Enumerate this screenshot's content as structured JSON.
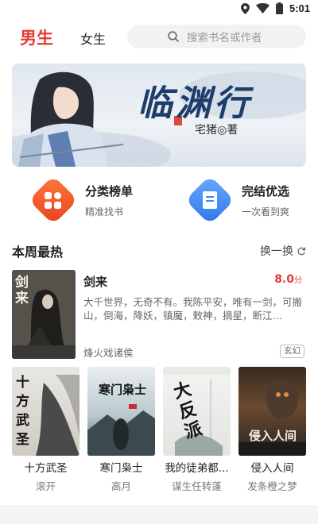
{
  "status_bar": {
    "time": "5:01",
    "icons": [
      "location-icon",
      "wifi-icon",
      "battery-icon"
    ]
  },
  "header": {
    "tabs": [
      {
        "label": "男生",
        "active": true
      },
      {
        "label": "女生",
        "active": false
      }
    ],
    "search_placeholder": "搜索书名或作者"
  },
  "banner": {
    "title": "临渊行",
    "author": "宅猪◎著"
  },
  "features": [
    {
      "title": "分类榜单",
      "subtitle": "精准找书",
      "icon": "grid-icon",
      "color": "#f15a24"
    },
    {
      "title": "完结优选",
      "subtitle": "一次看到爽",
      "icon": "book-icon",
      "color": "#3d8af7"
    }
  ],
  "section": {
    "title": "本周最热",
    "more_label": "换一换"
  },
  "featured_book": {
    "title": "剑来",
    "score": "8.0",
    "score_unit": "分",
    "description": "大千世界，无奇不有。我陈平安，唯有一剑，可搬山，倒海，降妖，镇魔，敕神，摘星，断江…",
    "author": "烽火戏诸侯",
    "tag": "玄幻",
    "cover_text": "剑来"
  },
  "books": [
    {
      "title": "十方武圣",
      "author": "滚开",
      "cover_text": "十方武圣"
    },
    {
      "title": "寒门枭士",
      "author": "高月",
      "cover_text": "寒门枭士"
    },
    {
      "title": "我的徒弟都...",
      "author": "谋生任转蓬",
      "cover_text": "大反派"
    },
    {
      "title": "侵入人间",
      "author": "发条橙之梦",
      "cover_text": "侵入人间"
    }
  ],
  "colors": {
    "accent": "#e53935"
  }
}
